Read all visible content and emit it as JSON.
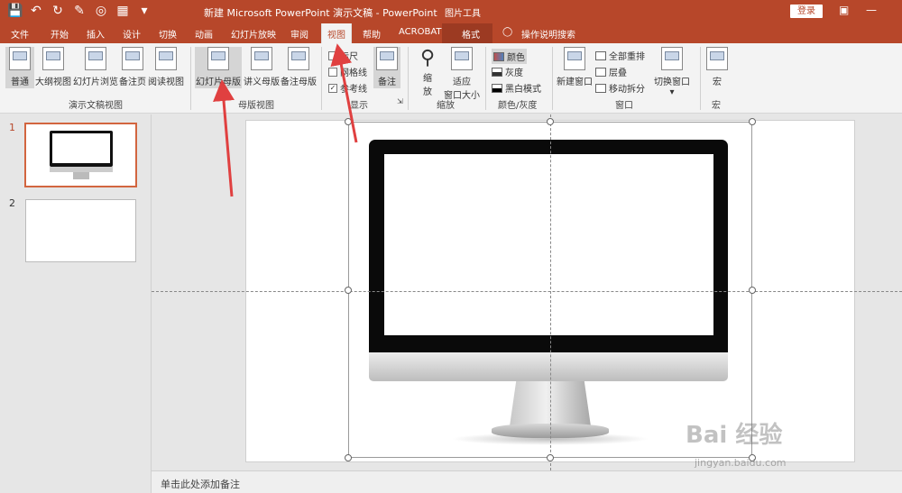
{
  "titlebar": {
    "doc_title": "新建 Microsoft PowerPoint 演示文稿  -  PowerPoint",
    "tool_title": "图片工具",
    "login_label": "登录",
    "qat_icons": [
      "save-icon",
      "undo-icon",
      "redo-icon",
      "format-painter-icon",
      "touch-mode-icon",
      "align-icon",
      "customize-qat-icon"
    ]
  },
  "tabs": [
    "文件",
    "开始",
    "插入",
    "设计",
    "切换",
    "动画",
    "幻灯片放映",
    "审阅",
    "视图",
    "帮助",
    "ACROBAT",
    "格式"
  ],
  "tell_me": "操作说明搜索",
  "ribbon": {
    "presentation_views": {
      "label": "演示文稿视图",
      "buttons": [
        "普通",
        "大纲视图",
        "幻灯片浏览",
        "备注页",
        "阅读视图"
      ]
    },
    "master_views": {
      "label": "母版视图",
      "buttons": [
        "幻灯片母版",
        "讲义母版",
        "备注母版"
      ]
    },
    "show": {
      "label": "显示",
      "items": [
        {
          "label": "标尺",
          "checked": false
        },
        {
          "label": "网格线",
          "checked": false
        },
        {
          "label": "参考线",
          "checked": true
        }
      ],
      "notes_label": "备注"
    },
    "zoom": {
      "label": "缩放",
      "zoom_button": "缩\n放",
      "fit_button": "适应\n窗口大小"
    },
    "color": {
      "label": "颜色/灰度",
      "items": [
        "颜色",
        "灰度",
        "黑白模式"
      ]
    },
    "window": {
      "label": "窗口",
      "new_window": "新建窗口",
      "items": [
        "全部重排",
        "层叠",
        "移动拆分"
      ],
      "switch_window": "切换窗口"
    },
    "macro": {
      "label": "宏",
      "button": "宏"
    }
  },
  "slides": [
    {
      "number": "1"
    },
    {
      "number": "2"
    }
  ],
  "notes_placeholder": "单击此处添加备注",
  "watermark": {
    "main": "Bai 经验",
    "sub": "jingyan.baidu.com"
  },
  "colors": {
    "accent": "#b7472a",
    "selection": "#d2653f",
    "arrow": "#e04040"
  }
}
